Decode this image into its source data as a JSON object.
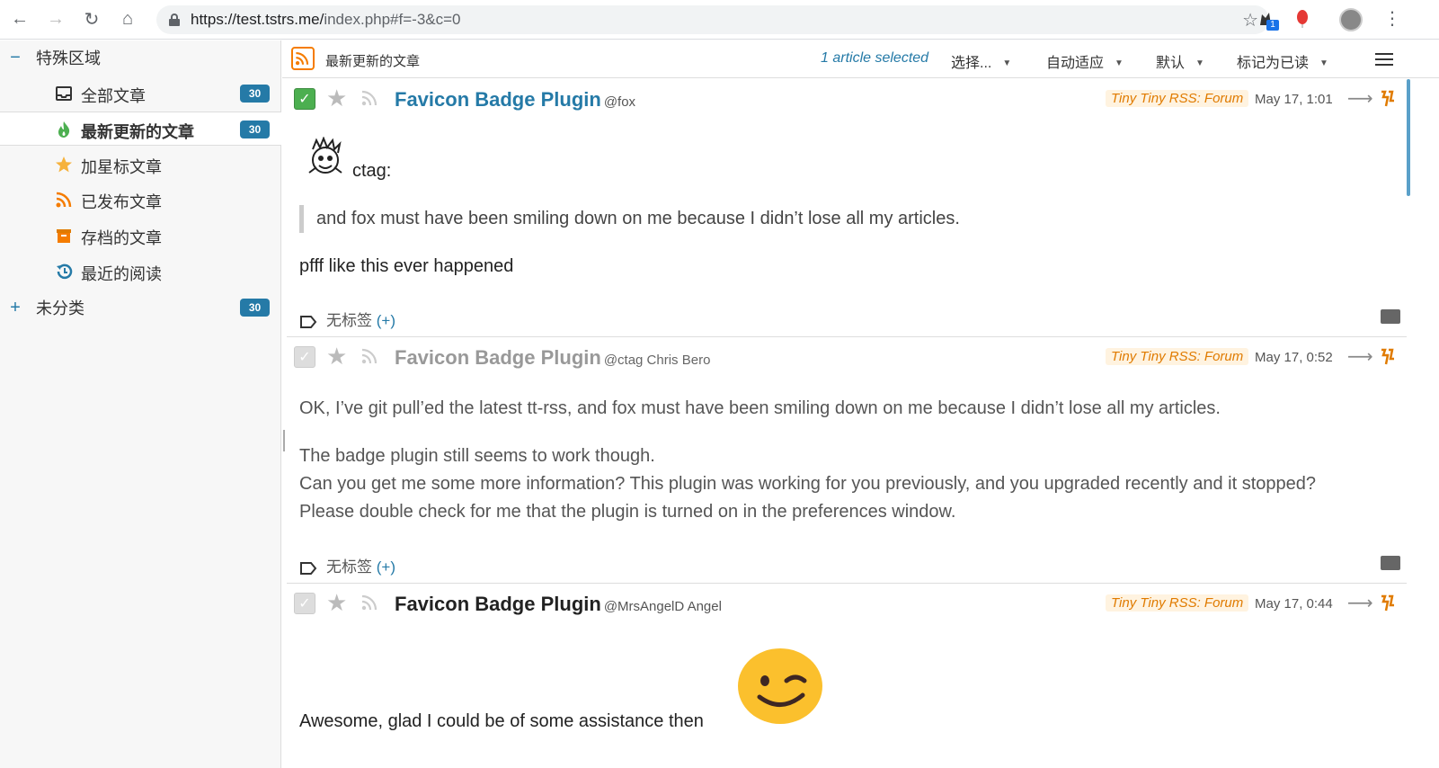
{
  "browser": {
    "url_host": "https://test.tstrs.me/",
    "url_path": "index.php#f=-3&c=0",
    "extension_badge": "1"
  },
  "sidebar": {
    "special": {
      "label": "特殊区域",
      "toggle": "−"
    },
    "feeds": [
      {
        "label": "全部文章",
        "count": "30",
        "icon": "inbox-icon"
      },
      {
        "label": "最新更新的文章",
        "count": "30",
        "icon": "fresh-icon",
        "selected": true
      },
      {
        "label": "加星标文章",
        "icon": "star-icon"
      },
      {
        "label": "已发布文章",
        "icon": "rss-icon"
      },
      {
        "label": "存档的文章",
        "icon": "archive-icon"
      },
      {
        "label": "最近的阅读",
        "icon": "history-icon"
      }
    ],
    "uncategorized": {
      "label": "未分类",
      "toggle": "+",
      "count": "30"
    }
  },
  "toolbar": {
    "title": "最新更新的文章",
    "selected_text": "1 article selected",
    "select_dd": "选择...",
    "view_dd": "自动适应",
    "sort_dd": "默认",
    "mark_dd": "标记为已读"
  },
  "articles": [
    {
      "title": "Favicon Badge Plugin",
      "author": "@fox",
      "feed": "Tiny Tiny RSS: Forum",
      "date": "May 17, 1:01",
      "checked": true,
      "quote_author": "ctag:",
      "quote": "and fox must have been smiling down on me because I didn’t lose all my articles.",
      "text": "pfff like this ever happened",
      "tags": "无标签",
      "tags_add": "(+)"
    },
    {
      "title": "Favicon Badge Plugin",
      "author": "@ctag Chris Bero",
      "feed": "Tiny Tiny RSS: Forum",
      "date": "May 17, 0:52",
      "checked": false,
      "p1": "OK, I’ve git pull’ed the latest tt-rss, and fox must have been smiling down on me because I didn’t lose all my articles.",
      "p2a": "The badge plugin still seems to work though.",
      "p2b": "Can you get me some more information? This plugin was working for you previously, and you upgraded recently and it stopped?",
      "p2c": "Please double check for me that the plugin is turned on in the preferences window.",
      "tags": "无标签",
      "tags_add": "(+)"
    },
    {
      "title": "Favicon Badge Plugin",
      "author": "@MrsAngelD Angel",
      "feed": "Tiny Tiny RSS: Forum",
      "date": "May 17, 0:44",
      "checked": false,
      "text": "Awesome, glad I could be of some assistance then"
    }
  ]
}
